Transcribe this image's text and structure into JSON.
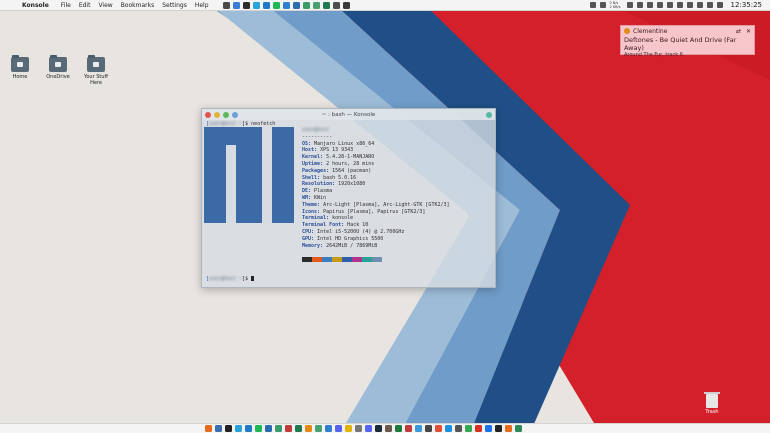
{
  "menubar": {
    "app_name": "Konsole",
    "items": [
      "File",
      "Edit",
      "View",
      "Bookmarks",
      "Settings",
      "Help"
    ]
  },
  "launchers": [
    {
      "icon": "files-icon",
      "color": "#4a4a4a"
    },
    {
      "icon": "chrome-icon",
      "color": "#3b7bd8"
    },
    {
      "icon": "terminal-icon",
      "color": "#2c2c2c"
    },
    {
      "icon": "telegram-icon",
      "color": "#2aa3d8"
    },
    {
      "icon": "vscode-icon",
      "color": "#1f7ac9"
    },
    {
      "icon": "spotify-icon",
      "color": "#1db954"
    },
    {
      "icon": "vscode-blue-icon",
      "color": "#2f80d1"
    },
    {
      "icon": "settings-icon",
      "color": "#2b6cb0"
    },
    {
      "icon": "text-editor-icon",
      "color": "#3a9c6a"
    },
    {
      "icon": "chat-icon",
      "color": "#4aa06e"
    },
    {
      "icon": "mail-icon",
      "color": "#1e7b4f"
    },
    {
      "icon": "back-icon",
      "color": "#4d4d4d"
    },
    {
      "icon": "steam-icon",
      "color": "#3a3a3a"
    }
  ],
  "tray": {
    "net_up": "0 B/s",
    "net_down": "2 KB/s",
    "clock": "12:35:25"
  },
  "desktop_icons": [
    {
      "label": "Home"
    },
    {
      "label": "OneDrive"
    },
    {
      "label": "Your Stuff Here"
    }
  ],
  "notification": {
    "app": "Clementine",
    "title": "Deftones - Be Quiet And Drive (Far Away)",
    "subtitle": "Around The Fur, track 6"
  },
  "konsole": {
    "title": "~ : bash — Konsole",
    "prompt_user": "user@host",
    "command_line": "]$ neofetch",
    "header_user": "user@host",
    "dashes": "----------",
    "info": [
      {
        "key": "OS:",
        "value": " Manjaro Linux x86_64"
      },
      {
        "key": "Host:",
        "value": " XPS 13 9343"
      },
      {
        "key": "Kernel:",
        "value": " 5.4.28-1-MANJARO"
      },
      {
        "key": "Uptime:",
        "value": " 2 hours, 28 mins"
      },
      {
        "key": "Packages:",
        "value": " 1564 (pacman)"
      },
      {
        "key": "Shell:",
        "value": " bash 5.0.16"
      },
      {
        "key": "Resolution:",
        "value": " 1920x1080"
      },
      {
        "key": "DE:",
        "value": " Plasma"
      },
      {
        "key": "WM:",
        "value": " KWin"
      },
      {
        "key": "Theme:",
        "value": " Arc-Light [Plasma], Arc-Light-GTK [GTK2/3]"
      },
      {
        "key": "Icons:",
        "value": " Papirus [Plasma], Papirus [GTK2/3]"
      },
      {
        "key": "Terminal:",
        "value": " konsole"
      },
      {
        "key": "Terminal Font:",
        "value": " Hack 10"
      },
      {
        "key": "CPU:",
        "value": " Intel i5-5200U (4) @ 2.700GHz"
      },
      {
        "key": "GPU:",
        "value": " Intel HD Graphics 5500"
      },
      {
        "key": "Memory:",
        "value": " 2642MiB / 7869MiB"
      }
    ],
    "palette": [
      "#2b2b2b",
      "#e35b1c",
      "#3a7ec2",
      "#c89b16",
      "#2f5fa8",
      "#b0348f",
      "#2aa198",
      "#6f8fb0"
    ],
    "final_prompt_suffix": "]$ "
  },
  "trash": {
    "label": "Trash"
  },
  "dock": [
    {
      "icon": "dock-firefox-icon",
      "color": "#e66b1c"
    },
    {
      "icon": "dock-files-icon",
      "color": "#3c6fb0"
    },
    {
      "icon": "dock-terminal-icon",
      "color": "#222222"
    },
    {
      "icon": "dock-telegram-icon",
      "color": "#2aa3d8"
    },
    {
      "icon": "dock-vscode-icon",
      "color": "#1f7ac9"
    },
    {
      "icon": "dock-spotify-icon",
      "color": "#1db954"
    },
    {
      "icon": "dock-settings-icon",
      "color": "#2b6cb0"
    },
    {
      "icon": "dock-editor-icon",
      "color": "#3a9c6a"
    },
    {
      "icon": "dock-photos-icon",
      "color": "#c23b3b"
    },
    {
      "icon": "dock-mail-icon",
      "color": "#1e7b4f"
    },
    {
      "icon": "dock-music-icon",
      "color": "#e38a16"
    },
    {
      "icon": "dock-chat-icon",
      "color": "#4aa06e"
    },
    {
      "icon": "dock-store-icon",
      "color": "#2f80d1"
    },
    {
      "icon": "dock-vm-icon",
      "color": "#5865f2"
    },
    {
      "icon": "dock-notes-icon",
      "color": "#e0b400"
    },
    {
      "icon": "dock-calc-icon",
      "color": "#777777"
    },
    {
      "icon": "dock-discord-icon",
      "color": "#5865f2"
    },
    {
      "icon": "dock-steam-icon",
      "color": "#1b2838"
    },
    {
      "icon": "dock-gimp-icon",
      "color": "#6b5a4a"
    },
    {
      "icon": "dock-office-icon",
      "color": "#1f7a3a"
    },
    {
      "icon": "dock-pdf-icon",
      "color": "#c23b3b"
    },
    {
      "icon": "dock-weather-icon",
      "color": "#3a9ad8"
    },
    {
      "icon": "dock-clock-icon",
      "color": "#444444"
    },
    {
      "icon": "dock-git-icon",
      "color": "#e04e39"
    },
    {
      "icon": "dock-docker-icon",
      "color": "#1d8fe0"
    },
    {
      "icon": "dock-camera-icon",
      "color": "#555555"
    },
    {
      "icon": "dock-maps-icon",
      "color": "#34a853"
    },
    {
      "icon": "dock-calendar-icon",
      "color": "#d93025"
    },
    {
      "icon": "dock-contacts-icon",
      "color": "#1a73e8"
    },
    {
      "icon": "dock-inkscape-icon",
      "color": "#222222"
    },
    {
      "icon": "dock-video-icon",
      "color": "#e66b1c"
    },
    {
      "icon": "dock-update-icon",
      "color": "#2e8b57"
    }
  ]
}
